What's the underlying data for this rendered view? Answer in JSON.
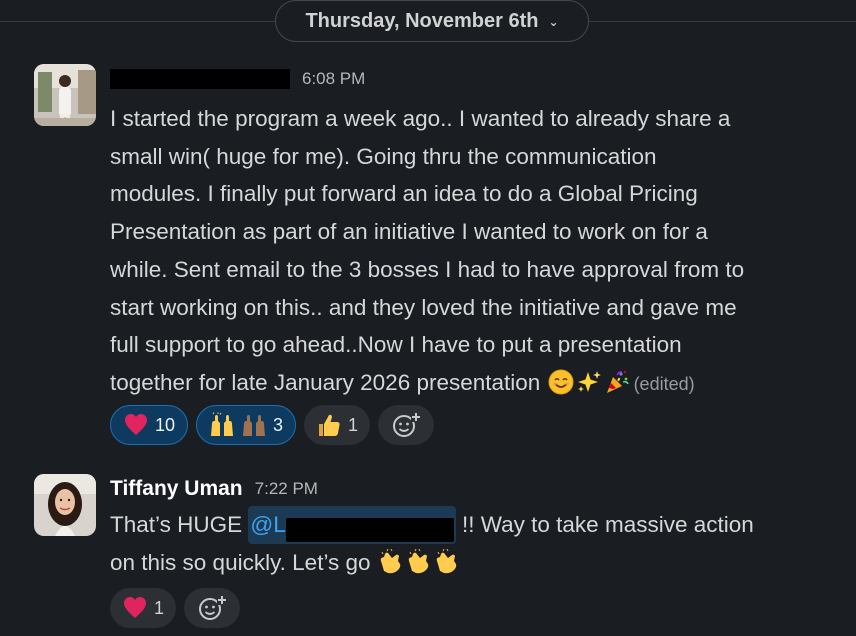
{
  "date_divider": {
    "label": "Thursday, November 6th"
  },
  "messages": [
    {
      "author": "",
      "time": "6:08 PM",
      "lines": [
        "I started the program a week ago.. I wanted to already share a",
        "small win( huge for me). Going thru the  communication",
        "modules. I finally put forward an idea to do a Global Pricing",
        "Presentation as part of an initiative I wanted to work on for a",
        "while. Sent email to the 3 bosses I had to have approval from to",
        "start working on this.. and they loved the initiative and gave me",
        "full support to go ahead..Now I have to put a presentation",
        "together for late January 2026 presentation"
      ],
      "trailing_emojis": [
        "smiling-face-icon",
        "sparkles-icon",
        "party-popper-icon"
      ],
      "edited_label": "(edited)",
      "reactions": [
        {
          "emoji": "red-heart-icon",
          "count": "10",
          "mine": true
        },
        {
          "emoji": "raised-hands-icon",
          "count": "3",
          "mine": true
        },
        {
          "emoji": "thumbs-up-icon",
          "count": "1",
          "mine": false
        }
      ]
    },
    {
      "author": "Tiffany Uman",
      "time": "7:22 PM",
      "text_before_mention": "That’s HUGE ",
      "mention_prefix": "@L",
      "text_after_mention": " !! Way to take massive action",
      "line2": "on this so quickly. Let’s go",
      "trailing_emojis": [
        "clapping-hands-icon",
        "clapping-hands-icon",
        "clapping-hands-icon"
      ],
      "reactions": [
        {
          "emoji": "red-heart-icon",
          "count": "1",
          "mine": false
        }
      ]
    }
  ],
  "colors": {
    "background": "#1a1d21",
    "reaction_mine_bg": "#0f3a5f",
    "reaction_mine_border": "#1d6fb5",
    "mention": "#3ea3f0"
  }
}
